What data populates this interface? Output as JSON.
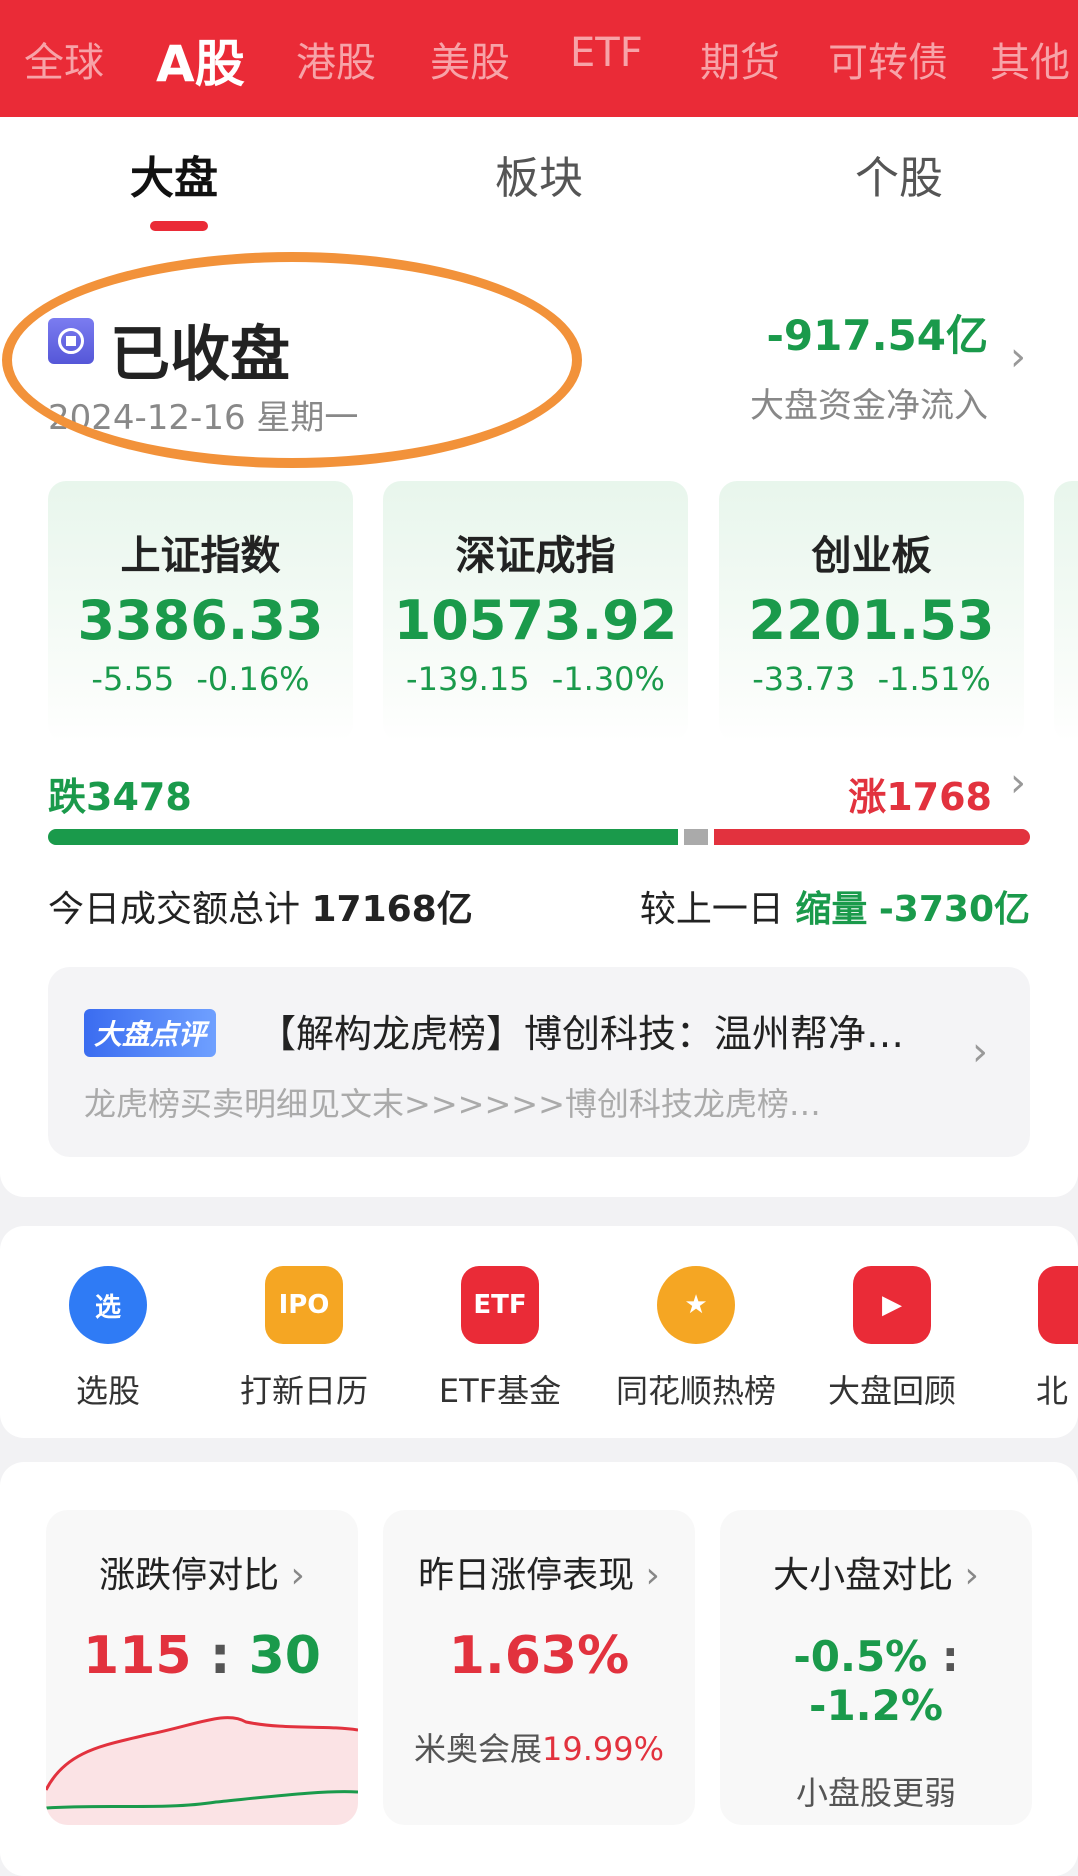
{
  "market_tabs": [
    "全球",
    "A股",
    "港股",
    "美股",
    "ETF",
    "期货",
    "可转债",
    "其他"
  ],
  "active_market": "A股",
  "sub_tabs": [
    "大盘",
    "板块",
    "个股"
  ],
  "status": {
    "title": "已收盘",
    "date": "2024-12-16 星期一",
    "flow_value": "-917.54亿",
    "flow_label": "大盘资金净流入"
  },
  "indices": [
    {
      "name": "上证指数",
      "value": "3386.33",
      "change": "-5.55",
      "pct": "-0.16%"
    },
    {
      "name": "深证成指",
      "value": "10573.92",
      "change": "-139.15",
      "pct": "-1.30%"
    },
    {
      "name": "创业板",
      "value": "2201.53",
      "change": "-33.73",
      "pct": "-1.51%"
    }
  ],
  "breadth": {
    "down": "跌3478",
    "up": "涨1768",
    "down_count": 3478,
    "up_count": 1768
  },
  "turnover": {
    "label": "今日成交额总计",
    "value": "17168亿",
    "compare": "较上一日",
    "trend": "缩量",
    "delta": "-3730亿"
  },
  "news": {
    "badge": "大盘点评",
    "title": "【解构龙虎榜】博创科技：温州帮净…",
    "summary": "龙虎榜买卖明细见文末>>>>>>博创科技龙虎榜…"
  },
  "tools": [
    {
      "label": "选股",
      "icon": "选",
      "color": "#2f7bf5"
    },
    {
      "label": "打新日历",
      "icon": "IPO",
      "color": "#f5a623"
    },
    {
      "label": "ETF基金",
      "icon": "ETF",
      "color": "#ea2b37"
    },
    {
      "label": "同花顺热榜",
      "icon": "★",
      "color": "#f5a623"
    },
    {
      "label": "大盘回顾",
      "icon": "▶",
      "color": "#ea2b37"
    },
    {
      "label": "北",
      "icon": "",
      "color": "#ea2b37"
    }
  ],
  "bottom_cards": [
    {
      "title": "涨跌停对比",
      "up": "115",
      "sep": ":",
      "down": "30"
    },
    {
      "title": "昨日涨停表现",
      "value": "1.63%",
      "stock": "米奥会展",
      "stock_pct": "19.99%"
    },
    {
      "title": "大小盘对比",
      "big": "-0.5%",
      "sep": ":",
      "small": "-1.2%",
      "note": "小盘股更弱"
    }
  ],
  "colors": {
    "brand": "#ea2b37",
    "down": "#1a9a4b",
    "up": "#e2323e",
    "annotation": "#f2923a"
  }
}
